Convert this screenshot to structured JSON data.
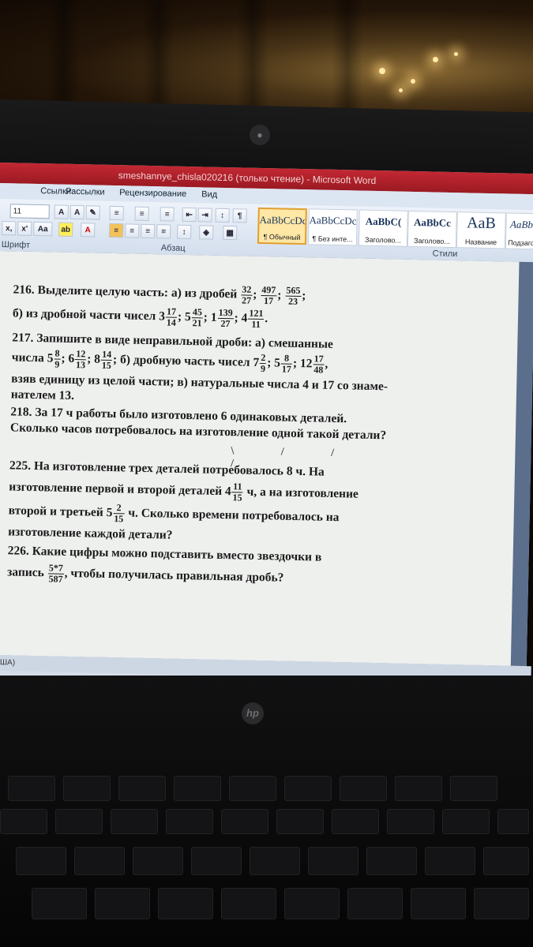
{
  "window": {
    "title": "smeshannye_chisla020216 (только чтение) - Microsoft Word"
  },
  "ribbon": {
    "tabs": [
      "Ссылки",
      "Рассылки",
      "Рецензирование",
      "Вид"
    ],
    "font_size": "11",
    "groups": {
      "font": "Шрифт",
      "paragraph": "Абзац",
      "styles": "Стили"
    },
    "styles": [
      {
        "sample": "AaBbCcDc",
        "name": "¶ Обычный",
        "active": true
      },
      {
        "sample": "AaBbCcDc",
        "name": "¶ Без инте...",
        "active": false
      },
      {
        "sample": "AaBbC(",
        "name": "Заголово...",
        "active": false
      },
      {
        "sample": "AaBbCc",
        "name": "Заголово...",
        "active": false
      },
      {
        "sample": "AaB",
        "name": "Название",
        "active": false
      },
      {
        "sample": "AaBb",
        "name": "Подзаго",
        "active": false
      }
    ]
  },
  "document": {
    "p216": {
      "num": "216.",
      "text_a": "Выделите целую часть: а) из дробей",
      "fractions_a": [
        {
          "n": "32",
          "d": "27"
        },
        {
          "n": "497",
          "d": "17"
        },
        {
          "n": "565",
          "d": "23"
        }
      ],
      "text_b": "б) из дробной части чисел",
      "mixed_b": [
        {
          "w": "3",
          "n": "17",
          "d": "14"
        },
        {
          "w": "5",
          "n": "45",
          "d": "21"
        },
        {
          "w": "1",
          "n": "139",
          "d": "27"
        },
        {
          "w": "4",
          "n": "121",
          "d": "11"
        }
      ]
    },
    "p217": {
      "num": "217.",
      "text_1": "Запишите в виде неправильной дроби: а) смешанные",
      "text_2": "числа",
      "mixed_a": [
        {
          "w": "5",
          "n": "8",
          "d": "9"
        },
        {
          "w": "6",
          "n": "12",
          "d": "13"
        },
        {
          "w": "8",
          "n": "14",
          "d": "15"
        }
      ],
      "text_3": "б) дробную часть чисел",
      "mixed_b": [
        {
          "w": "7",
          "n": "2",
          "d": "9"
        },
        {
          "w": "5",
          "n": "8",
          "d": "17"
        },
        {
          "w": "12",
          "n": "17",
          "d": "48"
        }
      ],
      "text_4": "взяв единицу из целой части; в) натуральные числа 4 и 17 со знаме-",
      "text_5": "нателем 13."
    },
    "p218": {
      "num": "218.",
      "text_1": "За 17 ч работы было изготовлено 6 одинаковых деталей.",
      "text_2": "Сколько часов потребовалось на изготовление одной такой детали?"
    },
    "p225": {
      "num": "225.",
      "text_1": "На изготовление трех деталей потребовалось 8 ч. На",
      "text_2a": "изготовление первой и второй деталей",
      "mixed_1": {
        "w": "4",
        "n": "11",
        "d": "15"
      },
      "text_2b": "ч, а на изготовление",
      "text_3a": "второй и третьей",
      "mixed_2": {
        "w": "5",
        "n": "2",
        "d": "15"
      },
      "text_3b": "ч. Сколько времени потребовалось на",
      "text_4": "изготовление каждой детали?"
    },
    "p226": {
      "num": "226.",
      "text_1": "Какие цифры можно подставить вместо звездочки в",
      "text_2a": "запись",
      "fraction": {
        "n": "5*7",
        "d": "587"
      },
      "text_2b": ", чтобы получилась правильная дробь?"
    }
  },
  "status": {
    "language": "США)"
  },
  "laptop": {
    "brand": "hp"
  }
}
